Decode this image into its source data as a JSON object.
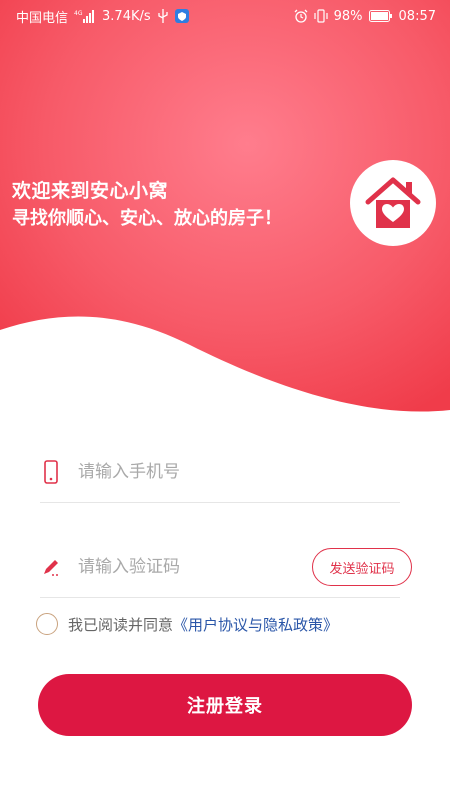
{
  "status_bar": {
    "carrier": "中国电信",
    "network_type": "4G",
    "speed": "3.74K/s",
    "battery": "98%",
    "time": "08:57"
  },
  "hero": {
    "title": "欢迎来到安心小窝",
    "subtitle": "寻找你顺心、安心、放心的房子！",
    "logo_icon": "house-heart-icon"
  },
  "form": {
    "phone_placeholder": "请输入手机号",
    "code_placeholder": "请输入验证码",
    "send_code_label": "发送验证码",
    "agree_prefix": "我已阅读并同意",
    "agree_link": "《用户协议与隐私政策》",
    "submit_label": "注册登录"
  },
  "colors": {
    "brand": "#dd1742",
    "hero_gradient_light": "#ff7a8c",
    "hero_gradient_dark": "#f2454f",
    "link": "#2a56a8",
    "icon_accent": "#e0324a"
  }
}
